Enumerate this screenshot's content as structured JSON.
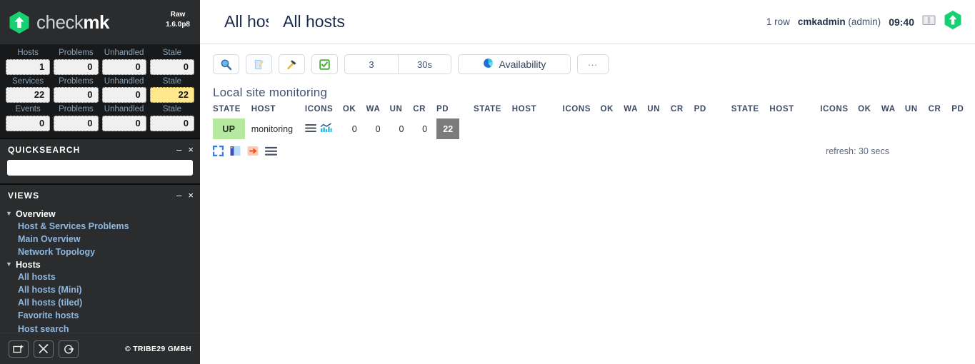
{
  "sidebar": {
    "logo": {
      "text_light": "check",
      "text_bold": "mk",
      "icon": "checkmk-hexagon-logo"
    },
    "version": {
      "edition": "Raw",
      "number": "1.6.0p8"
    },
    "tactical": {
      "rows": [
        {
          "name": "Hosts",
          "cells": [
            {
              "label": "Hosts",
              "value": "1",
              "warn": false
            },
            {
              "label": "Problems",
              "value": "0",
              "warn": false
            },
            {
              "label": "Unhandled",
              "value": "0",
              "warn": false
            },
            {
              "label": "Stale",
              "value": "0",
              "warn": false
            }
          ]
        },
        {
          "name": "Services",
          "cells": [
            {
              "label": "Services",
              "value": "22",
              "warn": false
            },
            {
              "label": "Problems",
              "value": "0",
              "warn": false
            },
            {
              "label": "Unhandled",
              "value": "0",
              "warn": false
            },
            {
              "label": "Stale",
              "value": "22",
              "warn": true
            }
          ]
        },
        {
          "name": "Events",
          "cells": [
            {
              "label": "Events",
              "value": "0",
              "warn": false
            },
            {
              "label": "Problems",
              "value": "0",
              "warn": false
            },
            {
              "label": "Unhandled",
              "value": "0",
              "warn": false
            },
            {
              "label": "Stale",
              "value": "0",
              "warn": false
            }
          ]
        }
      ]
    },
    "quicksearch": {
      "title": "QUICKSEARCH",
      "minimize": "–",
      "close": "×",
      "input_value": "",
      "input_placeholder": ""
    },
    "views": {
      "title": "VIEWS",
      "minimize": "–",
      "close": "×",
      "groups": [
        {
          "label": "Overview",
          "triangle": "▼",
          "items": [
            "Host & Services Problems",
            "Main Overview",
            "Network Topology"
          ]
        },
        {
          "label": "Hosts",
          "triangle": "▼",
          "items": [
            "All hosts",
            "All hosts (Mini)",
            "All hosts (tiled)",
            "Favorite hosts",
            "Host search"
          ]
        }
      ]
    },
    "footer": {
      "buttons": [
        {
          "icon": "add-snapin-icon"
        },
        {
          "icon": "tools-icon"
        },
        {
          "icon": "logout-icon"
        }
      ],
      "copyright": "© TRIBE29 GMBH"
    }
  },
  "header": {
    "title_clipped": "All hosts",
    "title": "All hosts",
    "rows": "1 row",
    "user": "cmkadmin",
    "user_role": "(admin)",
    "time": "09:40",
    "help_icon": "book-icon",
    "logo_icon": "checkmk-hexagon-logo"
  },
  "toolbar": {
    "buttons": [
      {
        "name": "search-button",
        "icon": "magnifier-icon",
        "label": ""
      },
      {
        "name": "edit-view-button",
        "icon": "edit-view-icon",
        "label": ""
      },
      {
        "name": "wato-button",
        "icon": "hammer-icon",
        "label": ""
      },
      {
        "name": "checkbox-button",
        "icon": "checkbox-icon",
        "label": ""
      },
      {
        "name": "column-count-button",
        "icon": "",
        "label": "3"
      },
      {
        "name": "refresh-interval-button",
        "icon": "",
        "label": "30s"
      },
      {
        "name": "availability-button",
        "icon": "pie-chart-icon",
        "label": "Availability"
      },
      {
        "name": "more-button",
        "icon": "",
        "label": "..."
      }
    ]
  },
  "table": {
    "title": "Local site monitoring",
    "columns": [
      "STATE",
      "HOST",
      "ICONS",
      "OK",
      "WA",
      "UN",
      "CR",
      "PD"
    ],
    "column_group_count": 3,
    "rows": [
      {
        "state": "UP",
        "host": "monitoring",
        "icons": [
          "hamburger-menu-icon",
          "bar-chart-icon"
        ],
        "ok": "0",
        "wa": "0",
        "un": "0",
        "cr": "0",
        "pd": "22"
      }
    ]
  },
  "table_footer": {
    "icons": [
      {
        "name": "expand-icon"
      },
      {
        "name": "column-layout-icon"
      },
      {
        "name": "export-icon"
      },
      {
        "name": "list-icon"
      }
    ],
    "refresh_text": "refresh: 30 secs"
  }
}
